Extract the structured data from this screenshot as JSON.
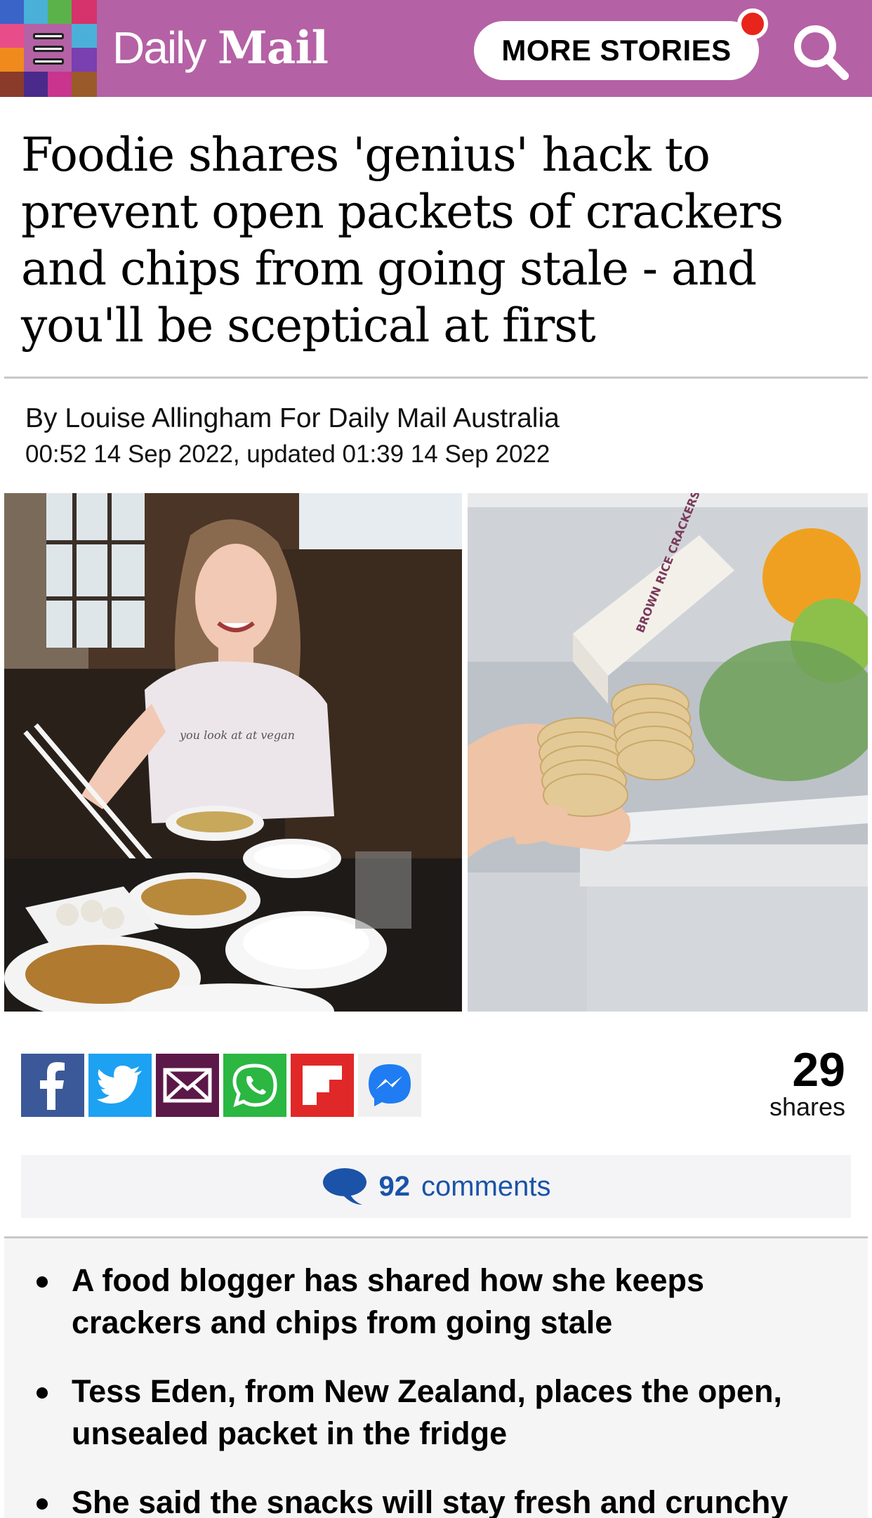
{
  "header": {
    "brand_daily": "Daily",
    "brand_mail": "Mail",
    "more_stories_label": "MORE STORIES",
    "bg_color": "#b561a5",
    "notification_color": "#e8251a"
  },
  "article": {
    "headline": "Foodie shares 'genius' hack to prevent open packets of crackers and chips from going stale - and you'll be sceptical at first",
    "byline": "By Louise Allingham For Daily Mail Australia",
    "dateline": "00:52 14 Sep 2022, updated 01:39 14 Sep 2022"
  },
  "photo_left_text": "you look at at vegan",
  "photo_right_text": "BROWN RICE CRACKERS",
  "share": {
    "buttons": [
      {
        "name": "facebook",
        "icon": "facebook-icon",
        "color": "#3b5998"
      },
      {
        "name": "twitter",
        "icon": "twitter-icon",
        "color": "#1da1f2"
      },
      {
        "name": "email",
        "icon": "email-icon",
        "color": "#5b1849"
      },
      {
        "name": "whatsapp",
        "icon": "whatsapp-icon",
        "color": "#2bb741"
      },
      {
        "name": "flipboard",
        "icon": "flipboard-icon",
        "color": "#e12828"
      },
      {
        "name": "messenger",
        "icon": "messenger-icon",
        "color": "#f0f0f0"
      }
    ],
    "count": "29",
    "count_label": "shares"
  },
  "comments": {
    "count": "92",
    "label": "comments"
  },
  "summary": {
    "bullets": [
      "A food blogger has shared how she keeps crackers and chips from going stale",
      "Tess Eden, from New Zealand, places the open, unsealed packet in the fridge",
      "She said the snacks will stay fresh and crunchy"
    ]
  }
}
